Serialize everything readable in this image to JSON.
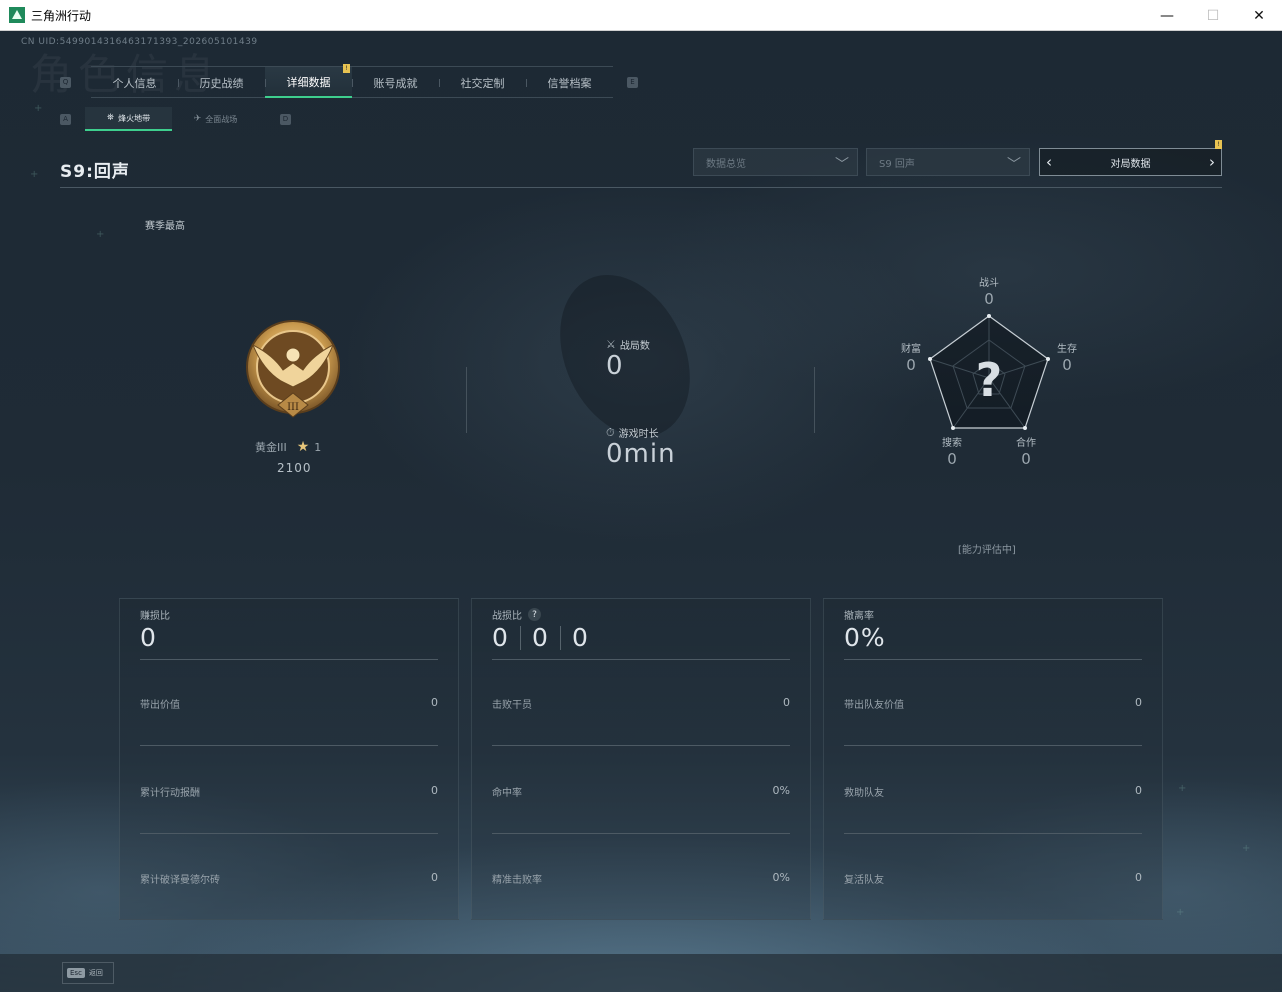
{
  "window": {
    "title": "三角洲行动",
    "minimize": "—",
    "maximize": "☐",
    "close": "✕"
  },
  "uid": "CN UID:5499014316463171393_202605101439",
  "background_watermark": "角色信息",
  "tabs": {
    "left_key": "Q",
    "right_key": "E",
    "items": [
      {
        "label": "个人信息"
      },
      {
        "label": "历史战绩"
      },
      {
        "label": "详细数据",
        "active": true,
        "badge": "!"
      },
      {
        "label": "账号成就"
      },
      {
        "label": "社交定制"
      },
      {
        "label": "信誉档案"
      }
    ]
  },
  "subtabs": {
    "left_key": "A",
    "right_key": "D",
    "items": [
      {
        "label": "烽火地带",
        "icon": "⛯",
        "active": true
      },
      {
        "label": "全面战场",
        "icon": "✈"
      }
    ]
  },
  "season": {
    "title": "S9:回声"
  },
  "filters": {
    "data_summary": {
      "value": "数据总览",
      "chevron": "﹀"
    },
    "season_select": {
      "value": "S9 回声",
      "chevron": "﹀"
    },
    "match_data": {
      "label": "对局数据",
      "prev": "‹",
      "next": "›",
      "badge": "!"
    }
  },
  "season_best": "赛季最高",
  "rank": {
    "numeral": "III",
    "name": "黄金III",
    "stars": "1",
    "score": "2100",
    "star_icon": "★"
  },
  "summary": {
    "matches": {
      "icon": "⚔",
      "label": "战局数",
      "value": "0"
    },
    "playtime": {
      "icon": "⏱",
      "label": "游戏时长",
      "value": "0min"
    }
  },
  "radar": {
    "question_mark": "?",
    "axes": [
      {
        "label": "战斗",
        "value": "0"
      },
      {
        "label": "生存",
        "value": "0"
      },
      {
        "label": "合作",
        "value": "0"
      },
      {
        "label": "搜索",
        "value": "0"
      },
      {
        "label": "财富",
        "value": "0"
      }
    ],
    "assessment": "[能力评估中]"
  },
  "panels": [
    {
      "title": "赚损比",
      "big": "0",
      "rows": [
        {
          "label": "带出价值",
          "value": "0"
        },
        {
          "label": "累计行动报酬",
          "value": "0"
        },
        {
          "label": "累计破译曼德尔砖",
          "value": "0"
        }
      ]
    },
    {
      "title": "战损比",
      "help": "?",
      "big_values": [
        "0",
        "0",
        "0"
      ],
      "rows": [
        {
          "label": "击败干员",
          "value": "0"
        },
        {
          "label": "命中率",
          "value": "0%"
        },
        {
          "label": "精准击败率",
          "value": "0%"
        }
      ]
    },
    {
      "title": "撤离率",
      "big": "0%",
      "rows": [
        {
          "label": "带出队友价值",
          "value": "0"
        },
        {
          "label": "救助队友",
          "value": "0"
        },
        {
          "label": "复活队友",
          "value": "0"
        }
      ]
    }
  ],
  "footer": {
    "key": "Esc",
    "label": "返回"
  },
  "colors": {
    "accent": "#3ecf8e",
    "badge": "#e8c352",
    "gold": "#c99a4e"
  }
}
